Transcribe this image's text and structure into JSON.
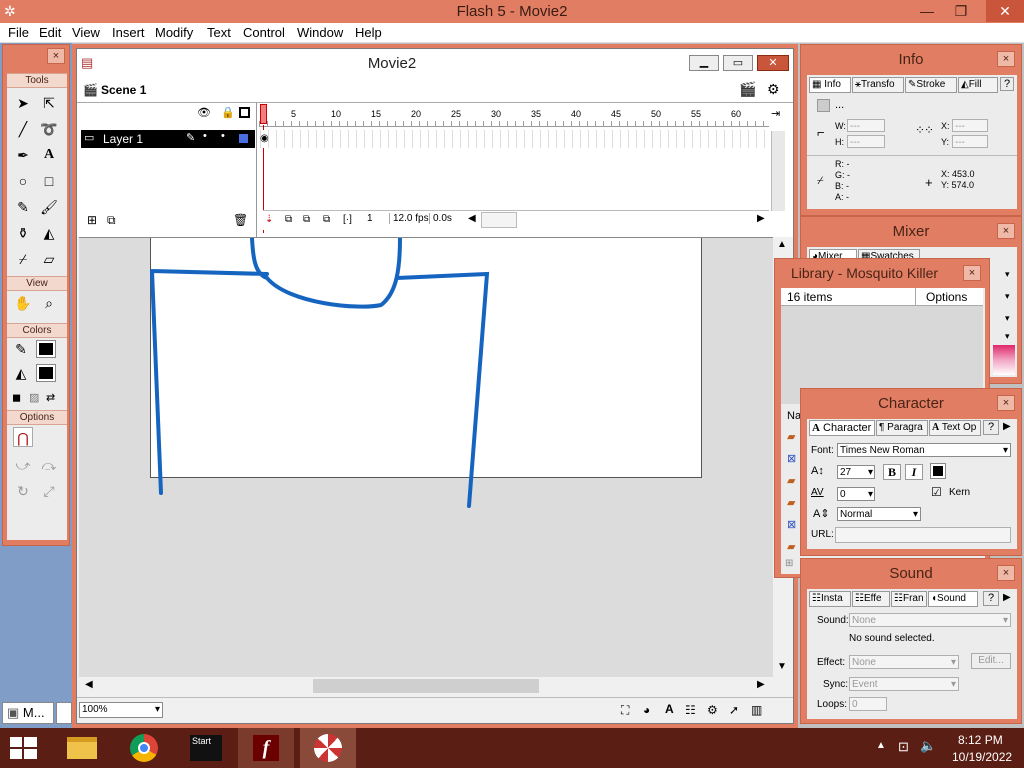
{
  "app": {
    "title": "Flash 5 - Movie2"
  },
  "menu": [
    "File",
    "Edit",
    "View",
    "Insert",
    "Modify",
    "Text",
    "Control",
    "Window",
    "Help"
  ],
  "tools": {
    "title": "Tools",
    "view_label": "View",
    "colors_label": "Colors",
    "options_label": "Options"
  },
  "movie": {
    "title": "Movie2",
    "scene": "Scene 1",
    "layer": "Layer 1",
    "frame_numbers": [
      "5",
      "10",
      "15",
      "20",
      "25",
      "30",
      "35",
      "40",
      "45",
      "50",
      "55",
      "60"
    ],
    "current_frame": "1",
    "fps": "12.0 fps",
    "time": "0.0s",
    "zoom": "100%"
  },
  "info": {
    "title": "Info",
    "tabs": [
      "Info",
      "Transfo",
      "Stroke",
      "Fill"
    ],
    "w": "W:",
    "h": "H:",
    "w_val": "---",
    "h_val": "---",
    "x": "X:",
    "y": "Y:",
    "x_val": "---",
    "y_val": "---",
    "rgba": "R: -\nG: -\nB: -\nA: -",
    "cursor_x": "X:  453.0",
    "cursor_y": "Y:  574.0",
    "dots": "..."
  },
  "mixer": {
    "title": "Mixer",
    "tabs": [
      "Mixer",
      "Swatches"
    ]
  },
  "library": {
    "title": "Library - Mosquito Killer",
    "count": "16 items",
    "options": "Options",
    "name_col": "Na"
  },
  "character": {
    "title": "Character",
    "tabs": [
      "Character",
      "Paragra",
      "Text Op"
    ],
    "font_label": "Font:",
    "font": "Times New Roman",
    "size": "27",
    "tracking": "0",
    "baseline": "Normal",
    "kern": "Kern",
    "bold": "B",
    "italic": "I",
    "url_label": "URL:"
  },
  "sound": {
    "title": "Sound",
    "tabs": [
      "Insta",
      "Effe",
      "Fran",
      "Sound"
    ],
    "sound_label": "Sound:",
    "sound_val": "None",
    "no_sound": "No sound selected.",
    "effect_label": "Effect:",
    "effect_val": "None",
    "edit": "Edit...",
    "sync_label": "Sync:",
    "sync_val": "Event",
    "loops_label": "Loops:",
    "loops_val": "0"
  },
  "taskbar": {
    "start_label": "Start",
    "time": "8:12 PM",
    "date": "10/19/2022",
    "minimized": "M..."
  },
  "colors": {
    "accent": "#e07d62",
    "stroke": "#1565c0"
  }
}
